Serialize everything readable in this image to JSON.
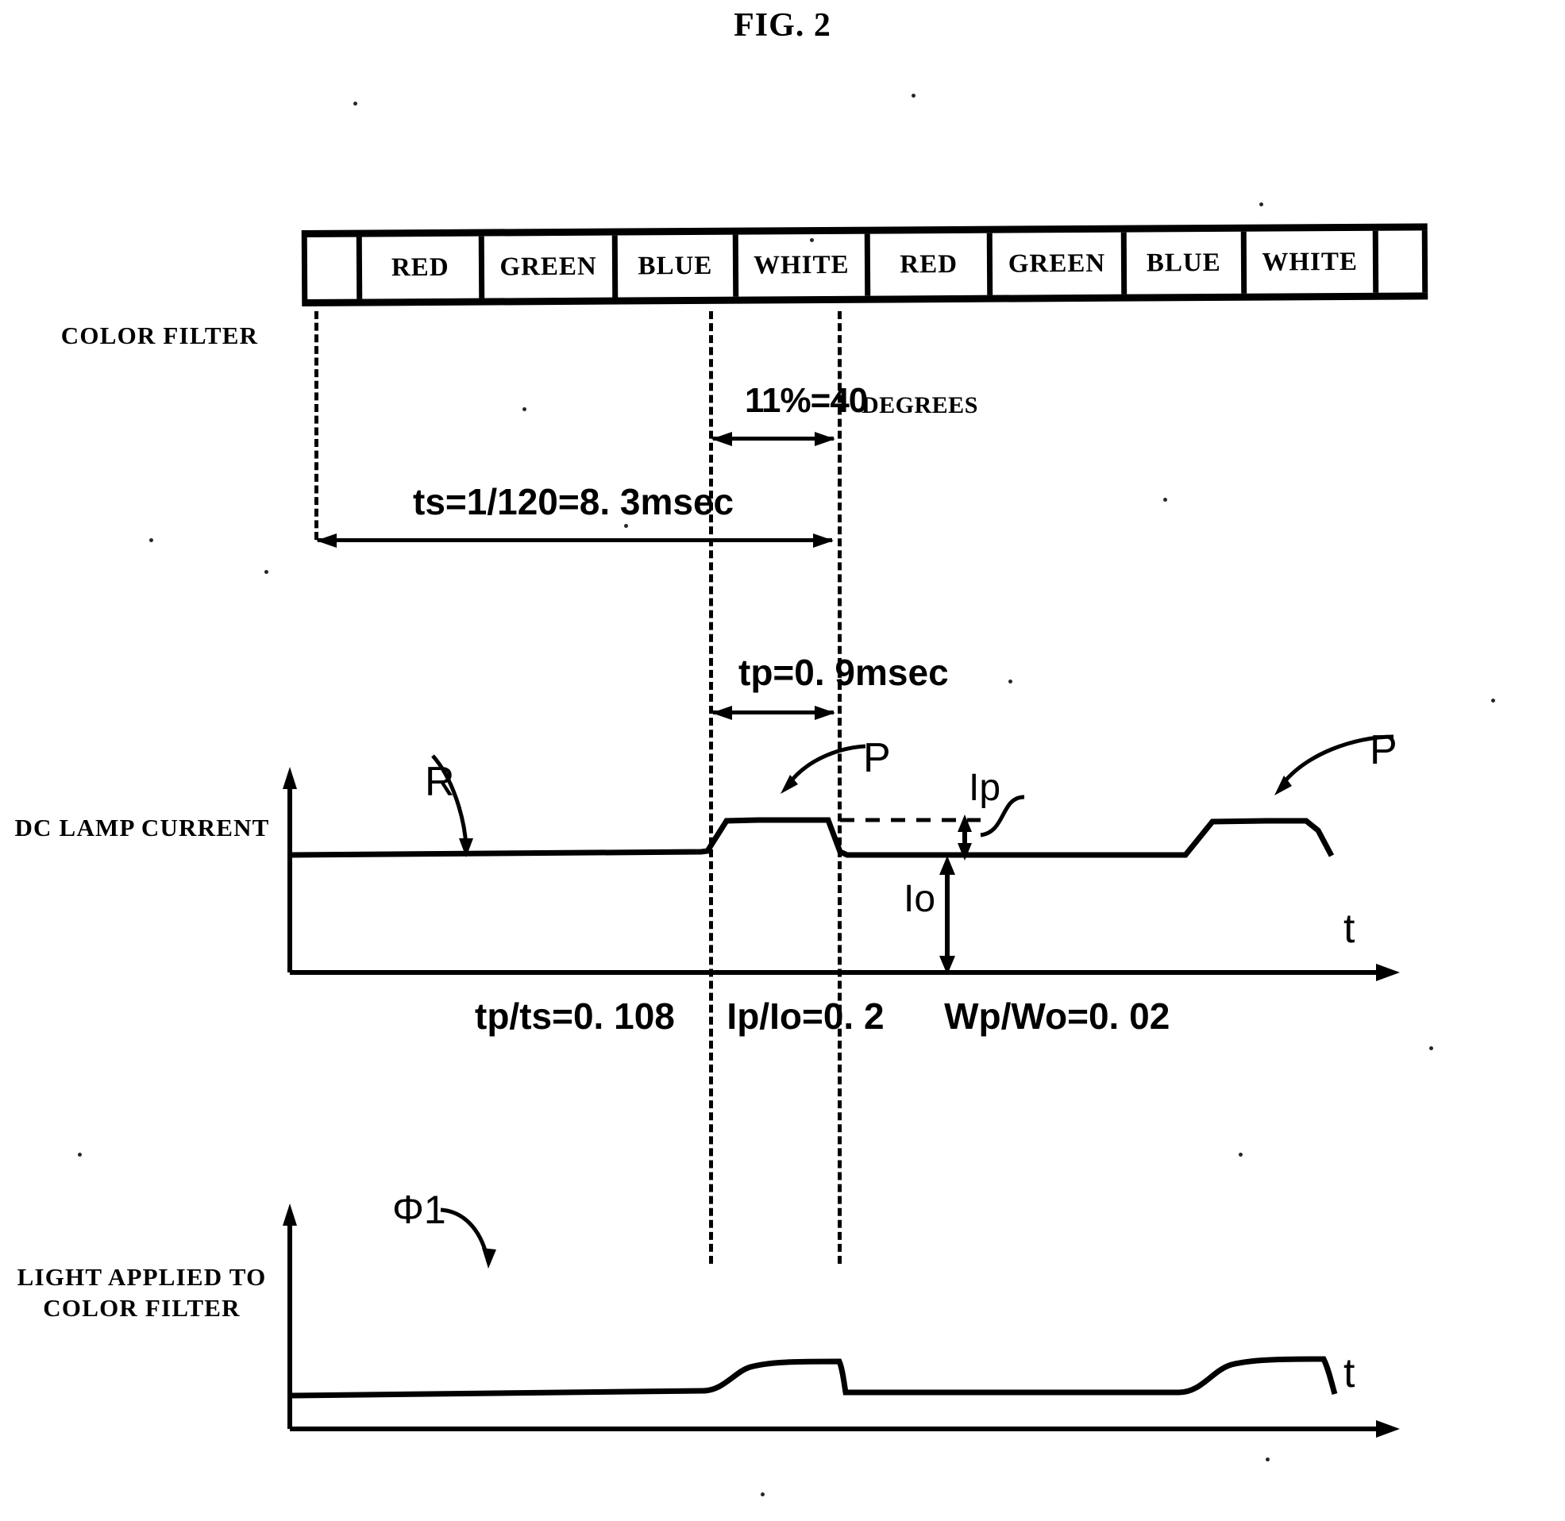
{
  "figure": {
    "title": "FIG. 2"
  },
  "rows": {
    "color_filter_label": "COLOR FILTER",
    "dc_lamp_label": "DC LAMP CURRENT",
    "light_label": "LIGHT APPLIED TO\nCOLOR FILTER"
  },
  "color_filter": {
    "cells": [
      {
        "label": ""
      },
      {
        "label": "RED"
      },
      {
        "label": "GREEN"
      },
      {
        "label": "BLUE"
      },
      {
        "label": "WHITE"
      },
      {
        "label": "RED"
      },
      {
        "label": "GREEN"
      },
      {
        "label": "BLUE"
      },
      {
        "label": "WHITE"
      },
      {
        "label": ""
      }
    ]
  },
  "annotations": {
    "pulse_fraction": "11%=40",
    "degrees": "DEGREES",
    "ts": "ts=1/120=8. 3msec",
    "tp": "tp=0. 9msec",
    "ratio_tp_ts": "tp/ts=0. 108",
    "ratio_ip_io": "Ip/Io=0. 2",
    "ratio_wp_wo": "Wp/Wo=0. 02"
  },
  "callouts": {
    "R": "R",
    "P_first": "P",
    "P_second": "P",
    "Ip": "Ip",
    "Io": "Io",
    "phi1": "Φ1"
  },
  "axes": {
    "t_dc": "t",
    "t_light": "t"
  },
  "chart_data": {
    "type": "line",
    "title": "FIG. 2",
    "xlabel": "t",
    "ylabel": "",
    "grid": false,
    "legend": "none",
    "series": [
      {
        "name": "DC LAMP CURRENT",
        "description": "Baseline current Io with trapezoidal boost pulses P of height Ip occurring during the WHITE filter segment",
        "baseline": 1.0,
        "pulse_height": 1.2,
        "pulse_points": [
          {
            "t": 0.0,
            "i": 1.0
          },
          {
            "t": 0.48,
            "i": 1.0
          },
          {
            "t": 0.505,
            "i": 1.2
          },
          {
            "t": 0.585,
            "i": 1.2
          },
          {
            "t": 0.61,
            "i": 1.0
          },
          {
            "t": 1.0,
            "i": 1.0
          }
        ]
      },
      {
        "name": "LIGHT APPLIED TO COLOR FILTER",
        "description": "Luminous flux phi1 with rounded rise during the boost pulse and sharp fall at pulse end",
        "baseline": 1.0,
        "pulse_height": 1.15,
        "pulse_points": [
          {
            "t": 0.0,
            "i": 1.0
          },
          {
            "t": 0.48,
            "i": 1.0
          },
          {
            "t": 0.53,
            "i": 1.15
          },
          {
            "t": 0.6,
            "i": 1.15
          },
          {
            "t": 0.61,
            "i": 1.0
          },
          {
            "t": 1.0,
            "i": 1.0
          }
        ]
      }
    ],
    "parameters": {
      "ts_sec": 0.0083,
      "ts_expression": "1/120 = 8.3 msec",
      "tp_sec": 0.0009,
      "tp_expression": "0.9 msec",
      "tp_over_ts": 0.108,
      "ip_over_io": 0.2,
      "wp_over_wo": 0.02,
      "pulse_percent_of_segment": 11,
      "pulse_degrees": 40
    }
  }
}
